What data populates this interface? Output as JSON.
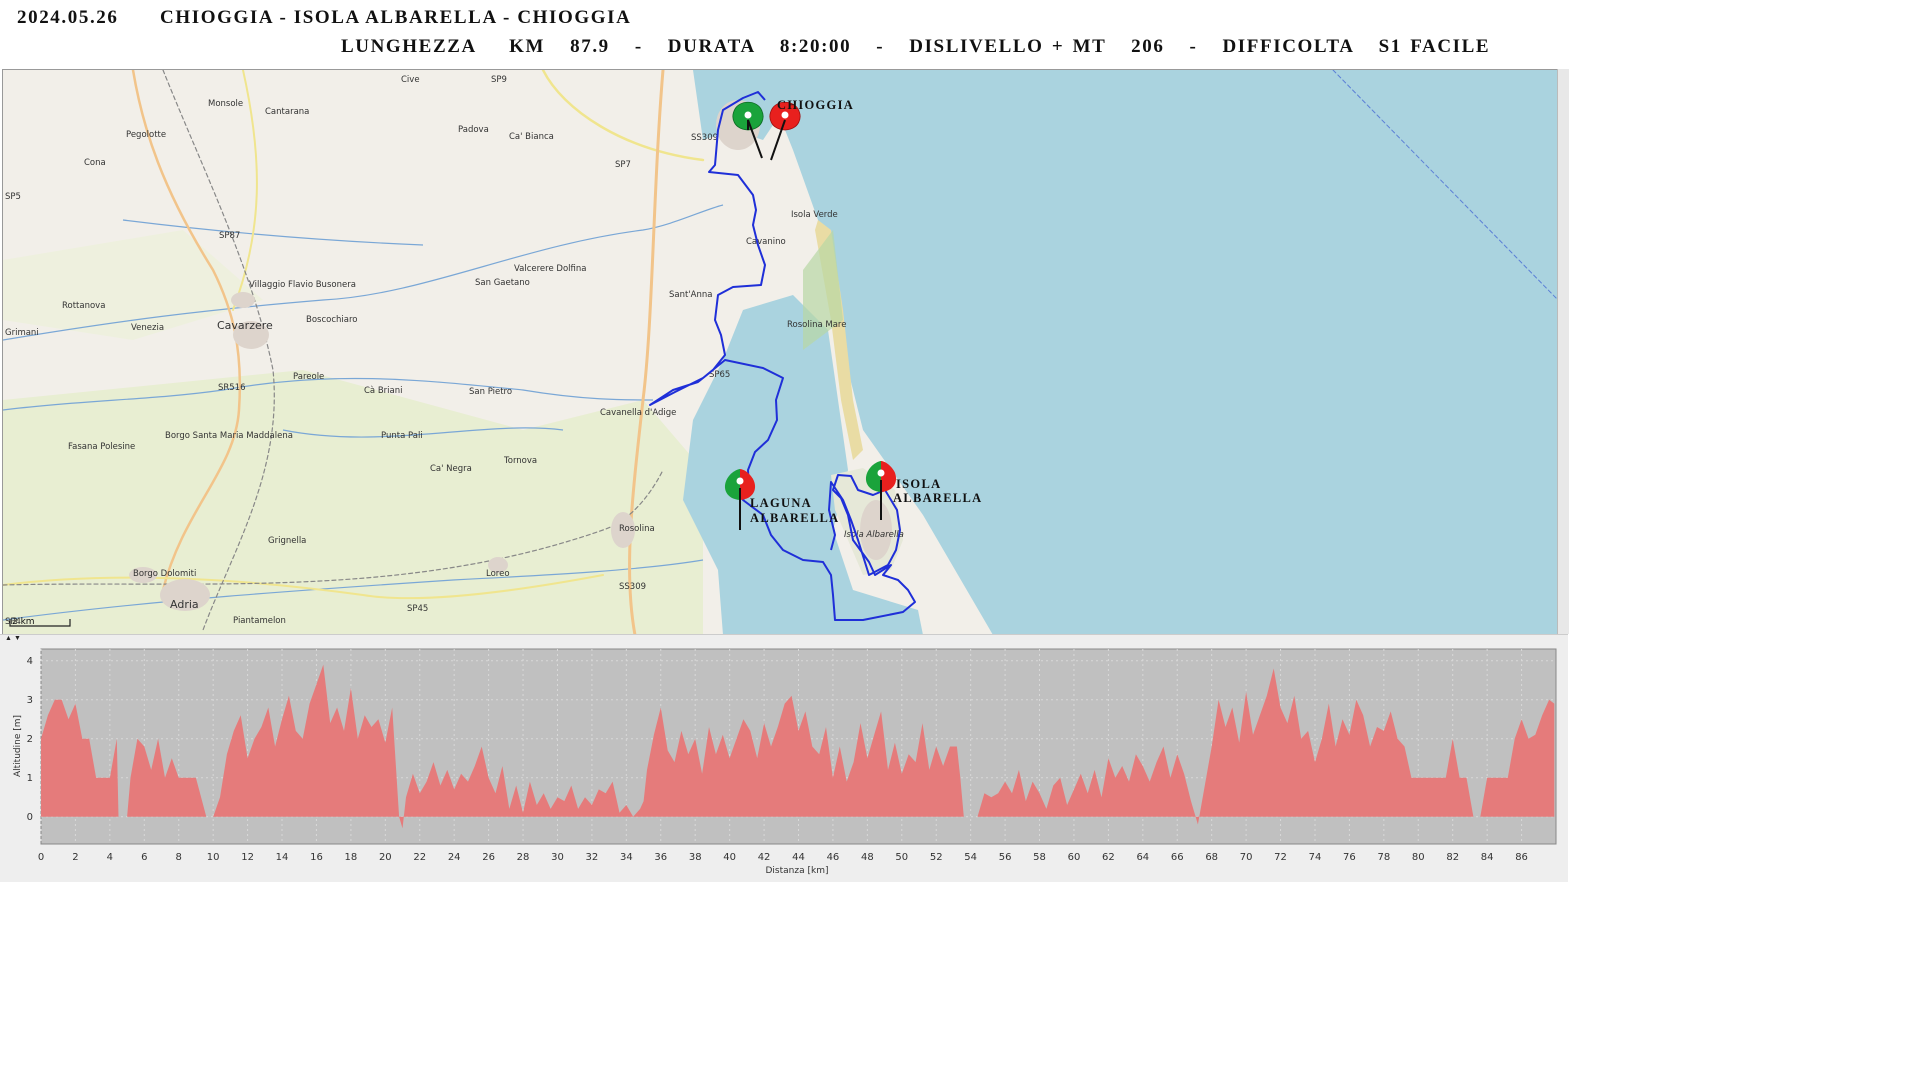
{
  "header": {
    "date": "2024.05.26",
    "title": "CHIOGGIA - ISOLA ALBARELLA - CHIOGGIA",
    "stats": "LUNGHEZZA    KM   87.9   -   DURATA   8:20:00   -   DISLIVELLO + MT   206   -   DIFFICOLTA   S1 FACILE"
  },
  "map": {
    "scale_label": "2 km",
    "waypoints": [
      {
        "name": "CHIOGGIA",
        "line2": ""
      },
      {
        "name": "ISOLA",
        "line2": "ALBARELLA"
      },
      {
        "name": "LAGUNA",
        "line2": "ALBARELLA"
      }
    ],
    "place_labels": [
      "Cive",
      "SP9",
      "Monsole",
      "Cantarana",
      "Pegolotte",
      "Padova",
      "Ca' Bianca",
      "SS309",
      "Cona",
      "SP7",
      "SP5",
      "Isola Verde",
      "SP87",
      "Cavanino",
      "Villaggio Flavio Busonera",
      "Valcerere Dolfina",
      "San Gaetano",
      "Sant'Anna",
      "Rottanova",
      "Cavarzere",
      "Boscochiaro",
      "Rosolina Mare",
      "Grimani",
      "Venezia",
      "SP65",
      "Pareole",
      "SR516",
      "Cà Briani",
      "San Pietro",
      "Cavanella d'Adige",
      "Fasana Polesine",
      "Borgo Santa Maria Maddalena",
      "Punta Pali",
      "Tornova",
      "Ca' Negra",
      "Isola Albarella",
      "Rosolina",
      "Grignella",
      "Borgo Dolomiti",
      "Loreo",
      "SS309",
      "Adria",
      "Piantamelon",
      "SP45",
      "SP4"
    ]
  },
  "colors": {
    "water": "#aad3df",
    "land": "#f2efe9",
    "fields": "#e8eed2",
    "route": "#1f2fd8",
    "profile_fill": "#e57b7b",
    "plot_bg": "#c0c0c0",
    "pin_green": "#1aa33b",
    "pin_red": "#e8201e"
  },
  "chart_data": {
    "type": "area",
    "xlabel": "Distanza [km]",
    "ylabel": "Altitudine [m]",
    "xlim": [
      0,
      88
    ],
    "ylim": [
      -0.7,
      4.3
    ],
    "x_ticks": [
      0,
      2,
      4,
      6,
      8,
      10,
      12,
      14,
      16,
      18,
      20,
      22,
      24,
      26,
      28,
      30,
      32,
      34,
      36,
      38,
      40,
      42,
      44,
      46,
      48,
      50,
      52,
      54,
      56,
      58,
      60,
      62,
      64,
      66,
      68,
      70,
      72,
      74,
      76,
      78,
      80,
      82,
      84,
      86
    ],
    "y_ticks": [
      0,
      1,
      2,
      3,
      4
    ],
    "x": [
      0,
      0.4,
      0.8,
      1.2,
      1.6,
      2.0,
      2.4,
      2.8,
      3.2,
      3.6,
      4.0,
      4.4,
      4.5,
      5.0,
      5.2,
      5.6,
      6.0,
      6.4,
      6.8,
      7.2,
      7.6,
      8.0,
      8.4,
      9.0,
      9.6,
      10.0,
      10.4,
      10.8,
      11.2,
      11.6,
      12.0,
      12.4,
      12.8,
      13.2,
      13.6,
      14.0,
      14.4,
      14.8,
      15.2,
      15.6,
      16.0,
      16.4,
      16.8,
      17.2,
      17.6,
      18.0,
      18.4,
      18.8,
      19.2,
      19.6,
      20.0,
      20.4,
      20.8,
      21.0,
      21.2,
      21.6,
      22.0,
      22.4,
      22.8,
      23.2,
      23.6,
      24.0,
      24.4,
      24.8,
      25.2,
      25.6,
      26.0,
      26.4,
      26.8,
      27.2,
      27.6,
      28.0,
      28.4,
      28.8,
      29.2,
      29.6,
      30.0,
      30.4,
      30.8,
      31.2,
      31.6,
      32.0,
      32.4,
      32.8,
      33.2,
      33.6,
      34.0,
      34.4,
      34.8,
      35.0,
      35.2,
      35.6,
      36.0,
      36.4,
      36.8,
      37.2,
      37.6,
      38.0,
      38.4,
      38.8,
      39.2,
      39.6,
      40.0,
      40.4,
      40.8,
      41.2,
      41.6,
      42.0,
      42.4,
      42.8,
      43.2,
      43.6,
      44.0,
      44.4,
      44.8,
      45.2,
      45.6,
      46.0,
      46.4,
      46.8,
      47.2,
      47.6,
      48.0,
      48.4,
      48.8,
      49.2,
      49.6,
      50.0,
      50.4,
      50.8,
      51.2,
      51.6,
      52.0,
      52.4,
      52.8,
      53.2,
      53.4,
      53.6,
      54.0,
      54.4,
      54.8,
      55.2,
      55.6,
      56.0,
      56.4,
      56.8,
      57.2,
      57.6,
      58.0,
      58.4,
      58.8,
      59.2,
      59.6,
      60.0,
      60.4,
      60.8,
      61.2,
      61.6,
      62.0,
      62.4,
      62.8,
      63.2,
      63.6,
      64.0,
      64.4,
      64.8,
      65.2,
      65.6,
      66.0,
      66.4,
      66.8,
      67.2,
      67.6,
      68.0,
      68.4,
      68.8,
      69.2,
      69.6,
      70.0,
      70.4,
      70.8,
      71.2,
      71.6,
      72.0,
      72.4,
      72.8,
      73.2,
      73.6,
      74.0,
      74.4,
      74.8,
      75.2,
      75.6,
      76.0,
      76.4,
      76.8,
      77.2,
      77.6,
      78.0,
      78.4,
      78.8,
      79.2,
      79.6,
      80.0,
      80.4,
      80.8,
      81.2,
      81.6,
      82.0,
      82.4,
      82.8,
      83.2,
      83.6,
      84.0,
      84.4,
      84.8,
      85.2,
      85.6,
      86.0,
      86.4,
      86.8,
      87.2,
      87.6,
      87.9
    ],
    "y": [
      2.0,
      2.6,
      3.0,
      3.0,
      2.5,
      2.9,
      2.0,
      2.0,
      1.0,
      1.0,
      1.0,
      2.0,
      0.0,
      0.0,
      1.0,
      2.0,
      1.8,
      1.2,
      2.0,
      1.0,
      1.5,
      1.0,
      1.0,
      1.0,
      0.0,
      0.0,
      0.5,
      1.6,
      2.2,
      2.6,
      1.5,
      2.0,
      2.3,
      2.8,
      1.8,
      2.5,
      3.1,
      2.2,
      2.0,
      2.9,
      3.4,
      3.9,
      2.4,
      2.8,
      2.2,
      3.3,
      2.0,
      2.6,
      2.3,
      2.5,
      1.9,
      2.8,
      0.0,
      -0.3,
      0.5,
      1.1,
      0.6,
      0.9,
      1.4,
      0.8,
      1.2,
      0.7,
      1.1,
      0.9,
      1.3,
      1.8,
      1.0,
      0.6,
      1.3,
      0.2,
      0.8,
      0.1,
      0.9,
      0.3,
      0.6,
      0.2,
      0.5,
      0.4,
      0.8,
      0.2,
      0.5,
      0.3,
      0.7,
      0.6,
      0.9,
      0.1,
      0.3,
      0.0,
      0.2,
      0.4,
      1.2,
      2.1,
      2.8,
      1.7,
      1.4,
      2.2,
      1.6,
      2.0,
      1.1,
      2.3,
      1.6,
      2.1,
      1.5,
      2.0,
      2.5,
      2.2,
      1.5,
      2.4,
      1.8,
      2.3,
      2.9,
      3.1,
      2.2,
      2.7,
      1.8,
      1.6,
      2.3,
      1.0,
      1.8,
      0.9,
      1.4,
      2.4,
      1.5,
      2.1,
      2.7,
      1.2,
      1.9,
      1.1,
      1.6,
      1.4,
      2.4,
      1.2,
      1.8,
      1.3,
      1.8,
      1.8,
      1.0,
      0.0,
      0.0,
      0.0,
      0.6,
      0.5,
      0.6,
      0.9,
      0.6,
      1.2,
      0.4,
      0.9,
      0.6,
      0.2,
      0.8,
      1.0,
      0.3,
      0.7,
      1.1,
      0.6,
      1.2,
      0.5,
      1.5,
      1.0,
      1.3,
      0.9,
      1.6,
      1.3,
      0.9,
      1.4,
      1.8,
      1.0,
      1.6,
      1.1,
      0.4,
      -0.2,
      0.8,
      1.8,
      3.0,
      2.3,
      2.8,
      1.9,
      3.2,
      2.1,
      2.6,
      3.1,
      3.8,
      2.8,
      2.4,
      3.1,
      2.0,
      2.2,
      1.4,
      2.0,
      2.9,
      1.8,
      2.5,
      2.1,
      3.0,
      2.6,
      1.8,
      2.3,
      2.2,
      2.7,
      2.0,
      1.8,
      1.0,
      1.0,
      1.0,
      1.0,
      1.0,
      1.0,
      2.0,
      1.0,
      1.0,
      0.0,
      0.0,
      1.0,
      1.0,
      1.0,
      1.0,
      2.0,
      2.5,
      2.0,
      2.1,
      2.6,
      3.0,
      2.9,
      2.5,
      2.0
    ]
  }
}
